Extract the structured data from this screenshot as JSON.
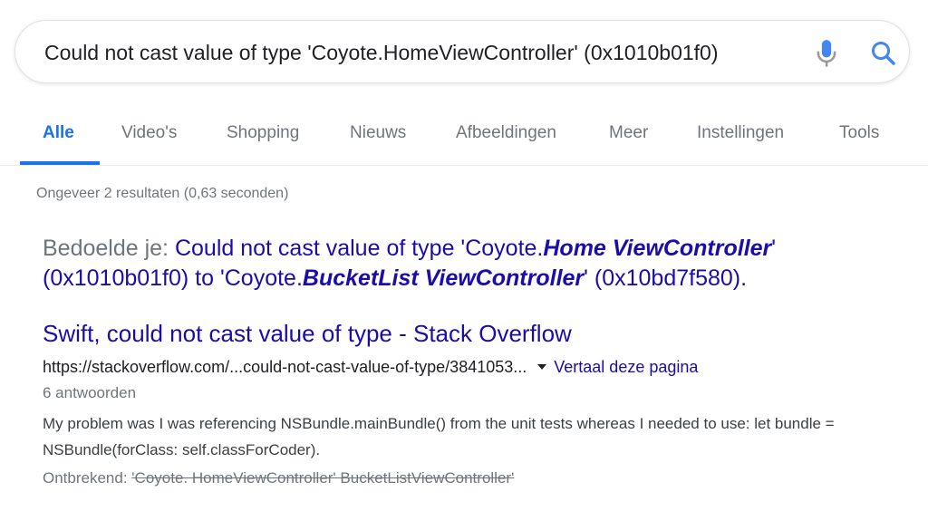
{
  "search": {
    "query": "Could not cast value of type 'Coyote.HomeViewController' (0x1010b01f0)"
  },
  "tabs": [
    {
      "label": "Alle"
    },
    {
      "label": "Video's"
    },
    {
      "label": "Shopping"
    },
    {
      "label": "Nieuws"
    },
    {
      "label": "Afbeeldingen"
    },
    {
      "label": "Meer"
    },
    {
      "label": "Instellingen"
    },
    {
      "label": "Tools"
    }
  ],
  "stats": "Ongeveer 2 resultaten (0,63 seconden)",
  "did_you_mean": {
    "label": "Bedoelde je:",
    "parts": [
      "Could not cast value of type 'Coyote.",
      "Home ViewController",
      "' (0x1010b01f0) to 'Coyote.",
      "BucketList ViewController",
      "' (0x10bd7f580)."
    ]
  },
  "result": {
    "title": "Swift, could not cast value of type - Stack Overflow",
    "url": "https://stackoverflow.com/...could-not-cast-value-of-type/3841053...",
    "translate": "Vertaal deze pagina",
    "answers": "6 antwoorden",
    "snippet": "My problem was I was referencing NSBundle.mainBundle() from the unit tests whereas I needed to use: let bundle = NSBundle(forClass: self.classForCoder).",
    "missing_label": "Ontbrekend:",
    "missing_terms": "'Coyote. HomeViewController' BucketListViewController'"
  },
  "colors": {
    "link": "#1a0dab",
    "accent": "#1a73e8",
    "muted": "#70757a"
  }
}
